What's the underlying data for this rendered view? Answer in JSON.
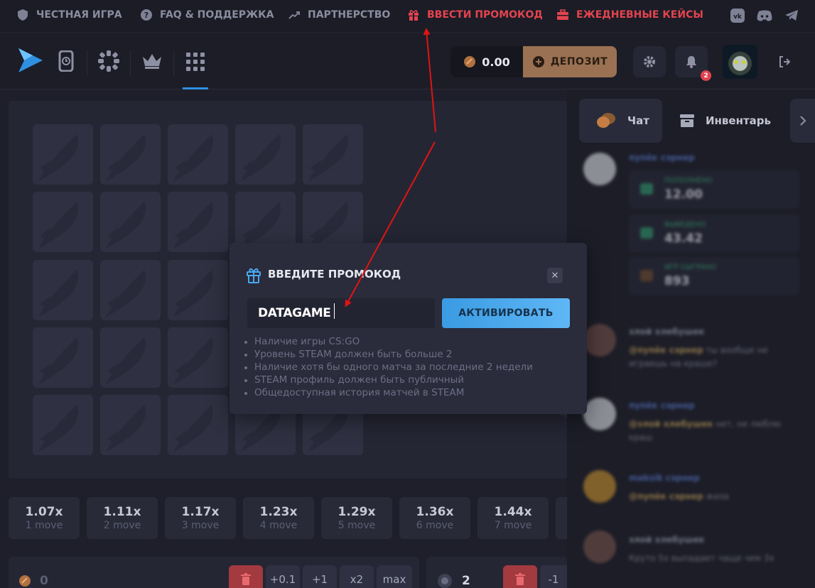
{
  "topbar": {
    "items": [
      {
        "label": "ЧЕСТНАЯ ИГРА",
        "icon": "shield-icon"
      },
      {
        "label": "FAQ & ПОДДЕРЖКА",
        "icon": "help-icon"
      },
      {
        "label": "ПАРТНЕРСТВО",
        "icon": "trend-icon"
      },
      {
        "label": "ВВЕСТИ ПРОМОКОД",
        "icon": "gift-icon"
      },
      {
        "label": "ЕЖЕДНЕВНЫЕ КЕЙСЫ",
        "icon": "case-icon"
      }
    ],
    "socials": [
      "vk-icon",
      "discord-icon",
      "telegram-icon"
    ]
  },
  "header": {
    "balance": "0.00",
    "deposit_label": "ДЕПОЗИТ",
    "notifications": "2",
    "game_icons": [
      "logo-icon",
      "timer-icon",
      "wheel-icon",
      "crown-icon",
      "grid-icon"
    ]
  },
  "multipliers": [
    {
      "value": "1.07x",
      "moves": "1 move"
    },
    {
      "value": "1.11x",
      "moves": "2 move"
    },
    {
      "value": "1.17x",
      "moves": "3 move"
    },
    {
      "value": "1.23x",
      "moves": "4 move"
    },
    {
      "value": "1.29x",
      "moves": "5 move"
    },
    {
      "value": "1.36x",
      "moves": "6 move"
    },
    {
      "value": "1.44x",
      "moves": "7 move"
    }
  ],
  "bet": {
    "amount": "0",
    "buttons": [
      "+0.1",
      "+1",
      "x2",
      "max"
    ],
    "mines": "2",
    "mines_button": "-1"
  },
  "sidebar": {
    "tabs": [
      {
        "label": "Чат",
        "icon": "chat-icon"
      },
      {
        "label": "Инвентарь",
        "icon": "inventory-icon"
      }
    ],
    "chat": {
      "message1_name": "пупёк сэрнер",
      "stat1_label": "ПОПОЛНЕНО",
      "stat1_value": "12.00",
      "stat2_label": "ВЫВЕДЕНО",
      "stat2_value": "43.42",
      "stat3_label": "ИГР СЫГРАНО",
      "stat3_value": "893",
      "message2_name": "злой хлебушек",
      "message2_mention": "@пупёк сэрнер",
      "message2_text": "ты вообще не играешь на краше?",
      "message3_name": "пупёк сэрнер",
      "message3_mention": "@злой хлебушек",
      "message3_text": "нет, не люблю краш",
      "message4_name": "maksik сэрнер",
      "message4_mention": "@пупёк сэрнер",
      "message4_text": "жиза",
      "message5_name": "злой хлебушек",
      "message5_text": "Круто 5х выпадает чаще чем 3х"
    }
  },
  "modal": {
    "title": "ВВЕДИТЕ ПРОМОКОД",
    "promo_value": "DATAGAME",
    "activate_label": "АКТИВИРОВАТЬ",
    "close_label": "✕",
    "requirements": [
      "Наличие игры CS:GO",
      "Уровень STEAM должен быть больше 2",
      "Наличие хотя бы одного матча за последние 2 недели",
      "STEAM профиль должен быть публичный",
      "Общедоступная история матчей в STEAM"
    ]
  },
  "colors": {
    "accent_red": "#e2444f",
    "accent_blue": "#4aa8ee",
    "deposit": "#9a7152",
    "annotation_arrow": "#e01414"
  }
}
